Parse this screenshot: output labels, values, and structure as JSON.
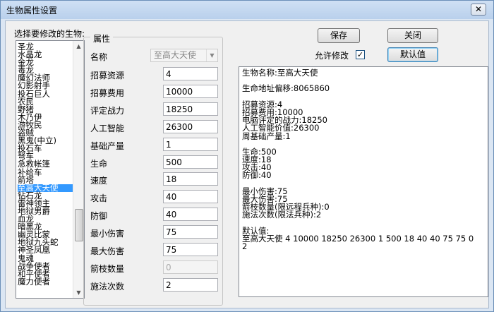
{
  "window": {
    "title": "生物属性设置",
    "close_glyph": "✕"
  },
  "list_label": "选择要修改的生物:",
  "creature_list": [
    "圣龙",
    "水晶龙",
    "金龙",
    "毒龙",
    "魔幻法师",
    "幻影射手",
    "投石巨人",
    "农民",
    "野猪",
    "木乃伊",
    "游牧民",
    "盗贼",
    "黑鬼(中立)",
    "投石车",
    "弩车",
    "急救帐篷",
    "补给车",
    "箭塔",
    "至高大天使",
    "钻石龙",
    "雷神领主",
    "地狱男爵",
    "血龙",
    "暗黑龙",
    "幽灵比蒙",
    "地狱九头蛇",
    "神圣凤凰",
    "鬼魂",
    "战争使者",
    "和平使者",
    "魔力使者"
  ],
  "selected_index": 18,
  "group": {
    "title": "属性",
    "name_label": "名称",
    "name_value": "至高大天使",
    "fields": [
      {
        "label": "招募资源",
        "value": "4"
      },
      {
        "label": "招募费用",
        "value": "10000"
      },
      {
        "label": "评定战力",
        "value": "18250"
      },
      {
        "label": "人工智能",
        "value": "26300"
      },
      {
        "label": "基础产量",
        "value": "1"
      },
      {
        "label": "生命",
        "value": "500"
      },
      {
        "label": "速度",
        "value": "18"
      },
      {
        "label": "攻击",
        "value": "40"
      },
      {
        "label": "防御",
        "value": "40"
      },
      {
        "label": "最小伤害",
        "value": "75"
      },
      {
        "label": "最大伤害",
        "value": "75"
      },
      {
        "label": "箭枝数量",
        "value": "0"
      },
      {
        "label": "施法次数",
        "value": "2"
      }
    ]
  },
  "buttons": {
    "save": "保存",
    "close": "关闭",
    "defaults": "默认值"
  },
  "allow_edit": {
    "label": "允许修改",
    "checked": true,
    "mark": "✓"
  },
  "info_lines": [
    "生物名称:至高大天使",
    "",
    "生命地址偏移:8065860",
    "",
    "招募资源:4",
    "招募费用:10000",
    "电脑评定的战力:18250",
    "人工智能价值:26300",
    "周基础产量:1",
    "",
    "生命:500",
    "速度:18",
    "攻击:40",
    "防御:40",
    "",
    "最小伤害:75",
    "最大伤害:75",
    "箭枝数量(限远程兵种):0",
    "施法次数(限法兵种):2",
    "",
    "默认值:",
    "至高大天使     4  10000  18250  26300  1  500  18  40  40  75  75  0",
    "2"
  ]
}
